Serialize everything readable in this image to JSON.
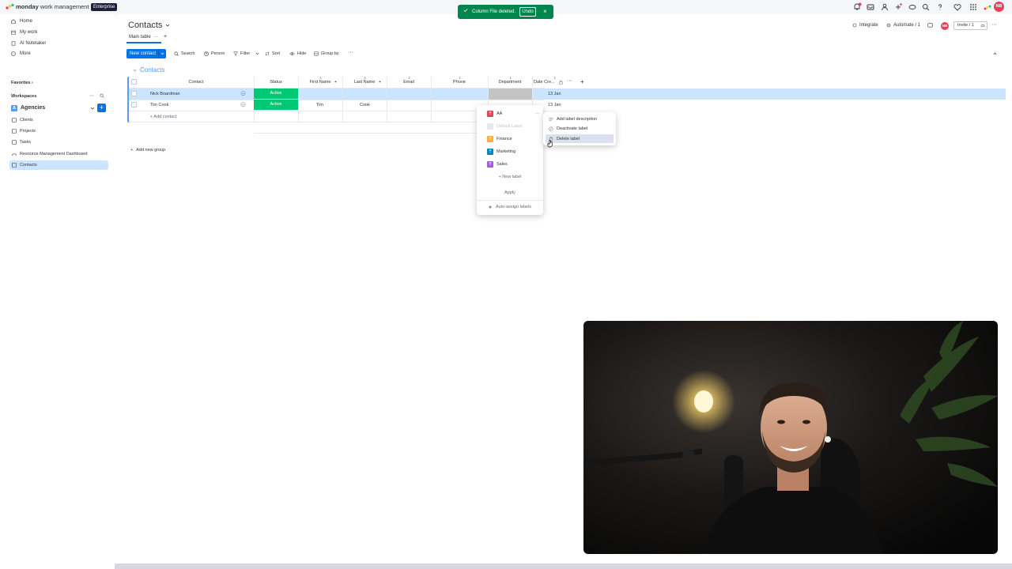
{
  "topbar": {
    "brand_bold": "monday",
    "brand_rest": " work management",
    "plan": "Enterprise",
    "avatar_initials": "NB"
  },
  "toast": {
    "message": "Column File deleted.",
    "undo": "Undo",
    "close": "×",
    "color": "#00854d"
  },
  "sidebar": {
    "nav": [
      {
        "label": "Home",
        "icon": "home-icon"
      },
      {
        "label": "My work",
        "icon": "calendar-icon"
      },
      {
        "label": "AI Notetaker",
        "icon": "notetaker-icon"
      },
      {
        "label": "More",
        "icon": "more-icon"
      }
    ],
    "favorites_label": "Favorites",
    "workspaces_label": "Workspaces",
    "workspace": {
      "badge": "A",
      "name": "Agencies"
    },
    "boards": [
      {
        "label": "Clients",
        "active": false
      },
      {
        "label": "Projects",
        "active": false
      },
      {
        "label": "Tasks",
        "active": false
      },
      {
        "label": "Resource Management Dashboard",
        "active": false
      },
      {
        "label": "Contacts",
        "active": true
      }
    ]
  },
  "header": {
    "title": "Contacts",
    "tab_main": "Main table",
    "integrate": "Integrate",
    "automate": "Automate / 1",
    "invite": "Invite / 1",
    "avatar_initials": "NB"
  },
  "toolbar": {
    "new_item": "New contact",
    "search": "Search",
    "person": "Person",
    "filter": "Filter",
    "sort": "Sort",
    "hide": "Hide",
    "group_by": "Group by"
  },
  "group": {
    "title": "Contacts",
    "color": "#579bfc",
    "columns": [
      "Contact",
      "Status",
      "First Name",
      "Last Name",
      "Email",
      "Phone",
      "Department",
      "Date Cre..."
    ],
    "rows": [
      {
        "contact": "Nick Boardman",
        "status": "Active",
        "first": "",
        "last": "",
        "date": "13 Jan"
      },
      {
        "contact": "Tim Cook",
        "status": "Active",
        "first": "Tim",
        "last": "Cook",
        "date": "13 Jan"
      }
    ],
    "add_item": "+ Add contact",
    "add_group": "Add new group",
    "status_color": "#00c875"
  },
  "label_menu": {
    "labels": [
      {
        "name": "AA",
        "color": "#e2445c",
        "disabled": false
      },
      {
        "name": "Default Label",
        "color": "#c4c4c4",
        "disabled": true
      },
      {
        "name": "Finance",
        "color": "#fdab3d",
        "disabled": false
      },
      {
        "name": "Marketing",
        "color": "#0086c0",
        "disabled": false
      },
      {
        "name": "Sales",
        "color": "#a25ddc",
        "disabled": false
      }
    ],
    "new_label": "+ New label",
    "apply": "Apply",
    "auto_assign": "Auto-assign labels"
  },
  "context_menu": {
    "items": [
      "Add label description",
      "Deactivate label",
      "Delete label"
    ]
  }
}
